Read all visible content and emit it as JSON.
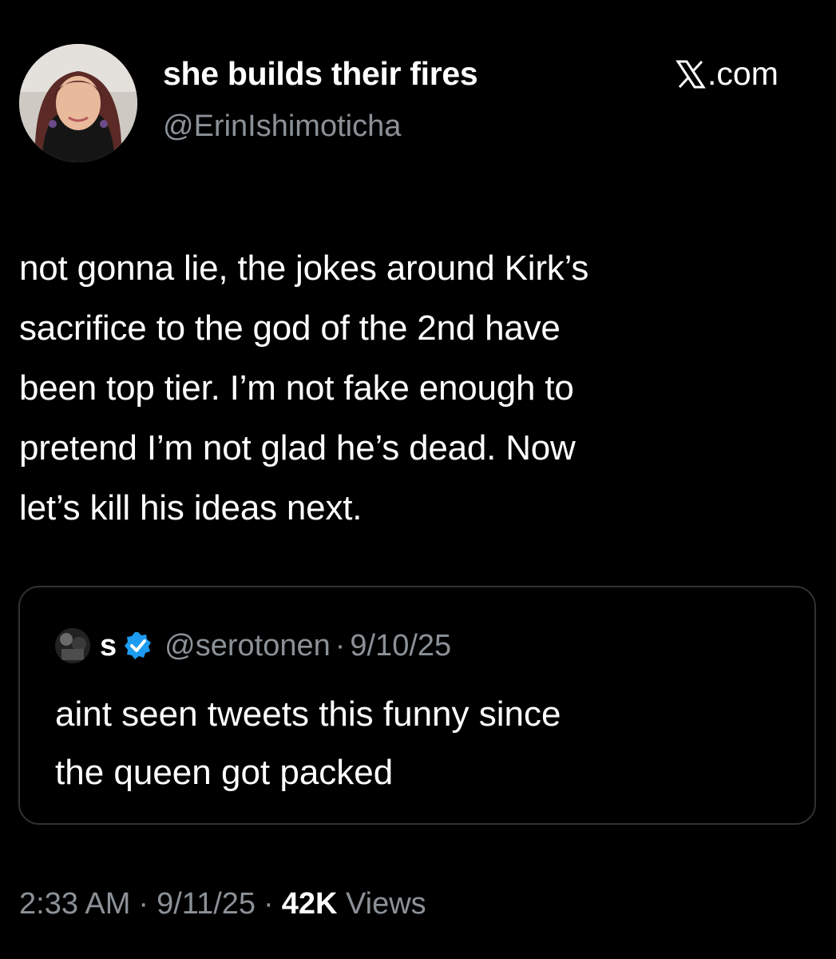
{
  "author": {
    "name": "she builds their fires",
    "handle": "@ErinIshimoticha"
  },
  "brand": {
    "label": ".com"
  },
  "tweet": {
    "lines": [
      "not gonna lie, the jokes around Kirk’s",
      "sacrifice to the god of the 2nd have",
      "been top tier. I’m not fake enough to",
      "pretend I’m not glad he’s dead. Now",
      "let’s kill his ideas next."
    ]
  },
  "quote": {
    "name": "s",
    "handle": "@serotonen",
    "separator": "·",
    "date": "9/10/25",
    "lines": [
      "aint seen tweets this funny since",
      "the queen got packed"
    ]
  },
  "meta": {
    "time": "2:33 AM",
    "date": "9/11/25",
    "separator": "·",
    "views_count": "42K",
    "views_label": "Views"
  },
  "colors": {
    "background": "#000000",
    "text": "#ffffff",
    "secondary": "#8b9197",
    "border": "#2f3336",
    "verified": "#1d9bf0"
  }
}
